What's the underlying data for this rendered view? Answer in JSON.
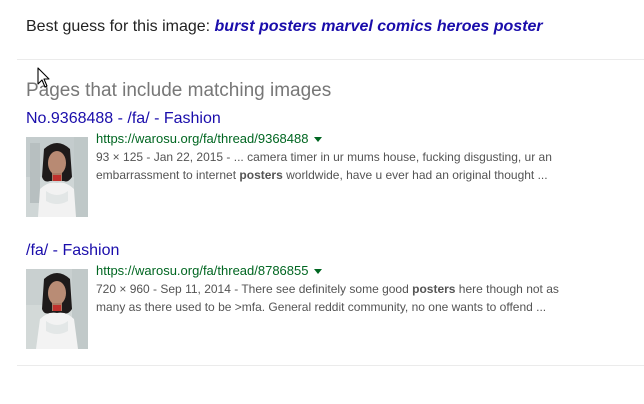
{
  "best_guess": {
    "prefix": "Best guess for this image: ",
    "query": "burst posters marvel comics heroes poster"
  },
  "section": {
    "title": "Pages that include matching images"
  },
  "results": [
    {
      "title": "No.9368488 - /fa/ - Fashion",
      "url": "https://warosu.org/fa/thread/9368488",
      "snippet_meta": "93 × 125 - Jan 22, 2015 - ... camera timer in ur mums house, fucking disgusting, ur an",
      "snippet_line2_pre": "embarrassment to internet ",
      "snippet_line2_bold": "posters",
      "snippet_line2_post": " worldwide, have u ever had an original thought ..."
    },
    {
      "title": "/fa/ - Fashion",
      "url": "https://warosu.org/fa/thread/8786855",
      "snippet_meta_pre": "720 × 960 - Sep 11, 2014 - There see definitely some good ",
      "snippet_meta_bold": "posters",
      "snippet_meta_post": " here though not as",
      "snippet_line2": "many as there used to be >mfa. General reddit community, no one wants to offend ..."
    }
  ],
  "icons": {
    "cursor": "mouse-pointer-icon",
    "url_arrow": "dropdown-arrow-icon"
  },
  "colors": {
    "link": "#1a0dab",
    "url": "#006621",
    "snippet": "#545454",
    "heading": "#777777"
  }
}
